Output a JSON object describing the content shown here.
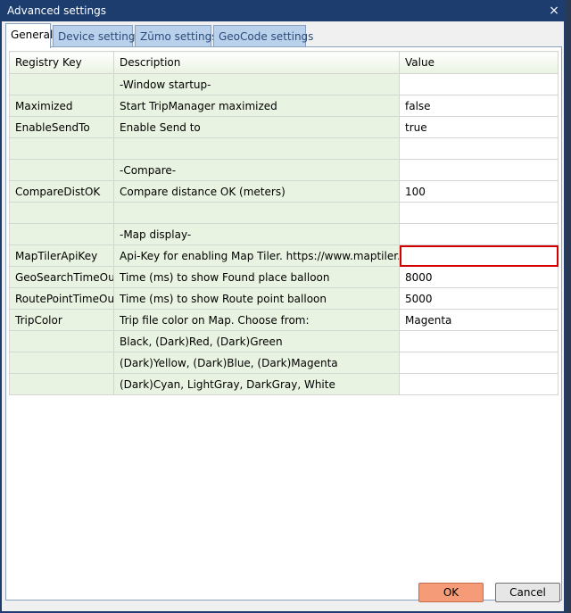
{
  "window": {
    "title": "Advanced settings",
    "close_glyph": "×"
  },
  "tabs": [
    {
      "label": "General"
    },
    {
      "label": "Device settings"
    },
    {
      "label": "Zūmo settings"
    },
    {
      "label": "GeoCode settings"
    }
  ],
  "table": {
    "headers": [
      "Registry Key",
      "Description",
      "Value"
    ],
    "rows": [
      {
        "key": "",
        "description": "-Window startup-",
        "value": ""
      },
      {
        "key": "Maximized",
        "description": "Start TripManager maximized",
        "value": "false"
      },
      {
        "key": "EnableSendTo",
        "description": "Enable Send to",
        "value": "true"
      },
      {
        "key": "",
        "description": "",
        "value": ""
      },
      {
        "key": "",
        "description": "-Compare-",
        "value": ""
      },
      {
        "key": "CompareDistOK",
        "description": "Compare distance OK (meters)",
        "value": "100"
      },
      {
        "key": "",
        "description": "",
        "value": ""
      },
      {
        "key": "",
        "description": "-Map display-",
        "value": ""
      },
      {
        "key": "MapTilerApiKey",
        "description": "Api-Key for enabling Map Tiler. https://www.maptiler.com",
        "value": ""
      },
      {
        "key": "GeoSearchTimeOut",
        "description": "Time (ms) to show Found place balloon",
        "value": "8000"
      },
      {
        "key": "RoutePointTimeOut",
        "description": "Time (ms) to show Route point balloon",
        "value": "5000"
      },
      {
        "key": "TripColor",
        "description": "Trip file color on Map. Choose from:",
        "value": "Magenta"
      },
      {
        "key": "",
        "description": "Black, (Dark)Red, (Dark)Green",
        "value": ""
      },
      {
        "key": "",
        "description": "(Dark)Yellow, (Dark)Blue, (Dark)Magenta",
        "value": ""
      },
      {
        "key": "",
        "description": "(Dark)Cyan, LightGray, DarkGray, White",
        "value": ""
      }
    ]
  },
  "buttons": {
    "ok": "OK",
    "cancel": "Cancel"
  }
}
